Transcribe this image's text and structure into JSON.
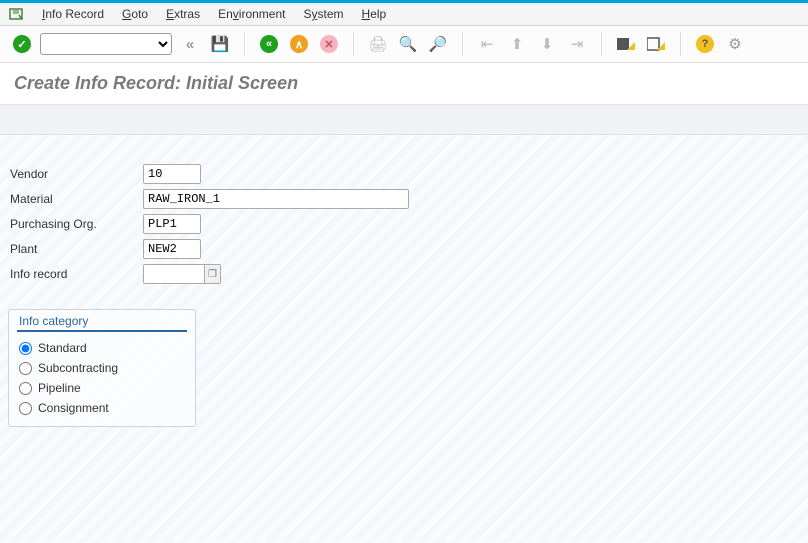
{
  "menu": {
    "items": [
      "Info Record",
      "Goto",
      "Extras",
      "Environment",
      "System",
      "Help"
    ]
  },
  "page": {
    "title": "Create Info Record: Initial Screen"
  },
  "form": {
    "vendor_label": "Vendor",
    "vendor_value": "10",
    "material_label": "Material",
    "material_value": "RAW_IRON_1",
    "porg_label": "Purchasing Org.",
    "porg_value": "PLP1",
    "plant_label": "Plant",
    "plant_value": "NEW2",
    "inforec_label": "Info record",
    "inforec_value": ""
  },
  "category": {
    "legend": "Info category",
    "opt_standard": "Standard",
    "opt_subcon": "Subcontracting",
    "opt_pipeline": "Pipeline",
    "opt_consign": "Consignment",
    "selected": "standard"
  }
}
